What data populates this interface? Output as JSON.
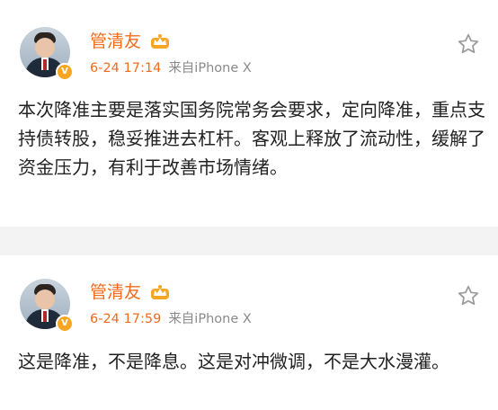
{
  "posts": [
    {
      "author": "管清友",
      "time": "6-24 17:14",
      "source": "来自iPhone X",
      "content": "本次降准主要是落实国务院常务会要求，定向降准，重点支持债转股，稳妥推进去杠杆。客观上释放了流动性，缓解了资金压力，有利于改善市场情绪。"
    },
    {
      "author": "管清友",
      "time": "6-24 17:59",
      "source": "来自iPhone X",
      "content": "这是降准，不是降息。这是对冲微调，不是大水漫灌。"
    }
  ],
  "colors": {
    "accent": "#f26b1d",
    "meta_gray": "#8a8a8a",
    "badge": "#f6a623"
  },
  "icons": [
    "avatar",
    "verified-v-icon",
    "crown-vip-icon",
    "star-outline-icon"
  ]
}
